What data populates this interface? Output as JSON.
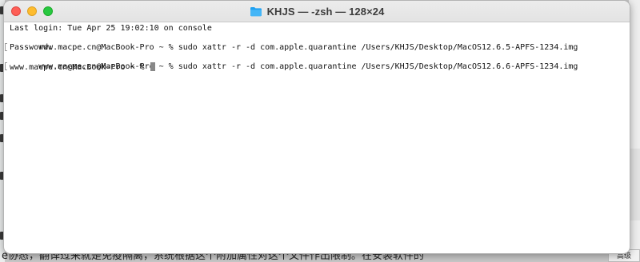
{
  "window": {
    "title": "KHJS — -zsh — 128×24",
    "folder_icon": "folder-icon",
    "folder_color": "#1ea1f2"
  },
  "terminal": {
    "lines": [
      "Last login: Tue Apr 25 19:02:10 on console",
      "www.macpe.cn@MacBook-Pro ~ % sudo xattr -r -d com.apple.quarantine /Users/KHJS/Desktop/MacOS12.6.5-APFS-1234.img",
      "Password:",
      "www.macpe.cn@MacBook-Pro ~ % sudo xattr -r -d com.apple.quarantine /Users/KHJS/Desktop/MacOS12.6.6-APFS-1234.img",
      "www.macpe.cn@MacBook-Pro ~ % "
    ]
  },
  "background": {
    "bottom_text": "e协态，翻译过来就是免疫隔离，系统根据这个附加属性对这个文件作出限制。在安装软件的",
    "right_tab_label": "高级"
  }
}
